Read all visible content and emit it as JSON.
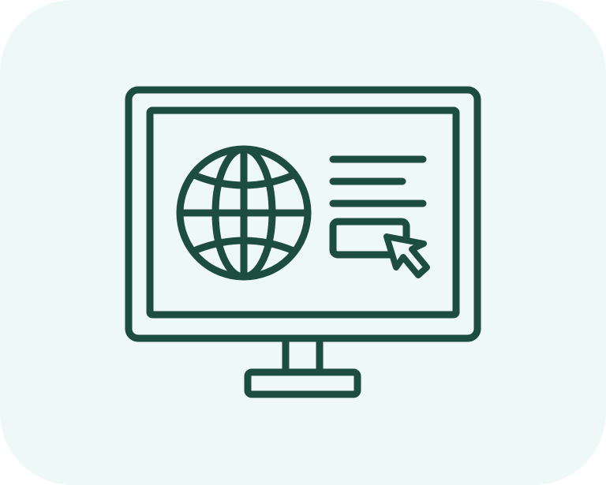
{
  "illustration": {
    "subject": "monitor-with-web-page-icon",
    "colors": {
      "background": "#eef8f6",
      "stroke": "#1d4d40"
    },
    "icons": [
      "monitor-icon",
      "globe-icon",
      "text-lines-icon",
      "button-icon",
      "cursor-arrow-icon"
    ]
  }
}
